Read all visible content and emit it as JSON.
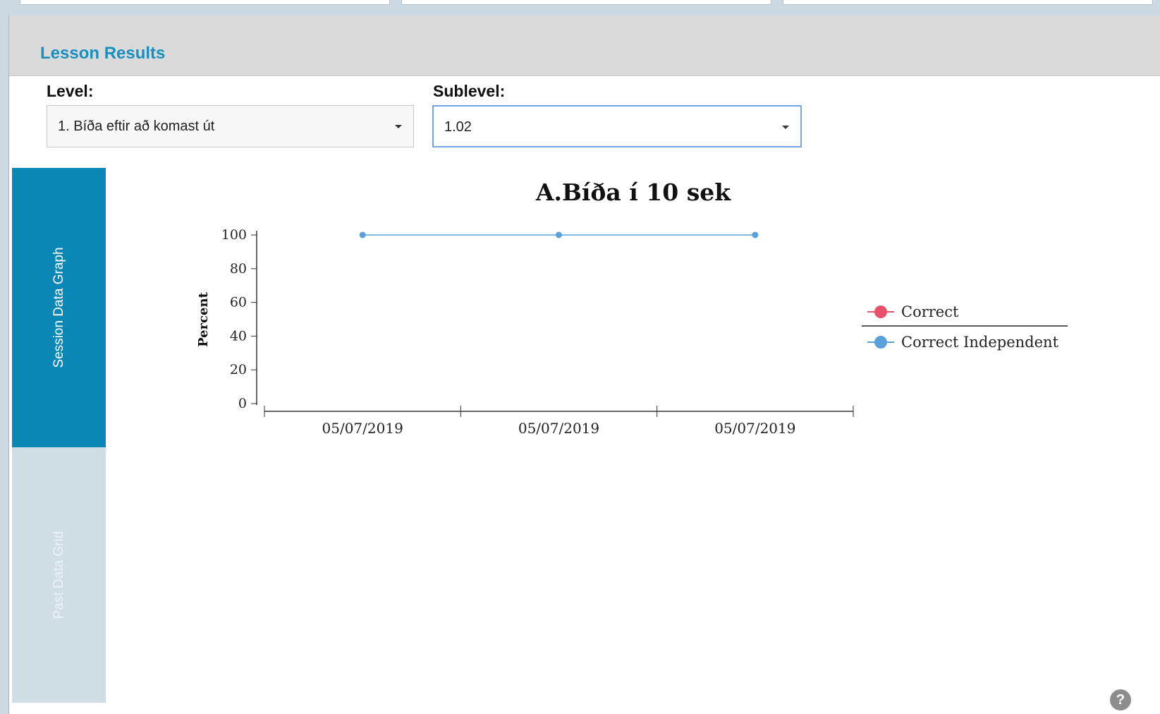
{
  "panel": {
    "title": "Lesson Results"
  },
  "filters": {
    "level_label": "Level:",
    "level_value": "1. Bíða eftir að komast út",
    "sublevel_label": "Sublevel:",
    "sublevel_value": "1.02"
  },
  "tabs": [
    {
      "label": "Session Data Graph",
      "active": true
    },
    {
      "label": "Past Data Grid",
      "active": false
    }
  ],
  "help": {
    "icon": "help-icon",
    "glyph": "?"
  },
  "chart_data": {
    "type": "line",
    "title": "A.Bíða í 10 sek",
    "ylabel": "Percent",
    "xlabel": "",
    "ylim": [
      0,
      100
    ],
    "yticks": [
      0,
      20,
      40,
      60,
      80,
      100
    ],
    "categories": [
      "05/07/2019",
      "05/07/2019",
      "05/07/2019"
    ],
    "series": [
      {
        "name": "Correct",
        "color": "#e8516a",
        "values": []
      },
      {
        "name": "Correct Independent",
        "color": "#5aa1dc",
        "values": [
          100,
          100,
          100
        ]
      }
    ],
    "legend": "right",
    "grid": false
  }
}
